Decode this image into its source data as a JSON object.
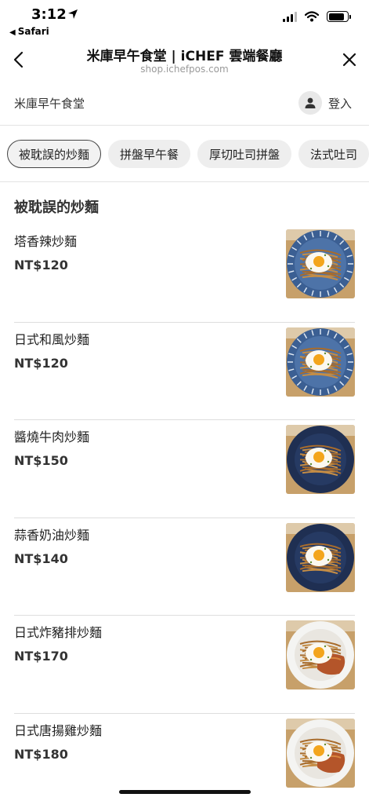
{
  "status_bar": {
    "time": "3:12",
    "back_app": "Safari",
    "signal_bars": 3,
    "battery_level": 0.85
  },
  "nav": {
    "title": "米庫早午食堂 | iCHEF 雲端餐廳",
    "url": "shop.ichefpos.com"
  },
  "store": {
    "name": "米庫早午食堂",
    "login_label": "登入"
  },
  "tabs": [
    {
      "label": "被耽誤的炒麵",
      "active": true
    },
    {
      "label": "拼盤早午餐",
      "active": false
    },
    {
      "label": "厚切吐司拼盤",
      "active": false
    },
    {
      "label": "法式吐司",
      "active": false
    }
  ],
  "section": {
    "title": "被耽誤的炒麵"
  },
  "items": [
    {
      "name": "塔香辣炒麵",
      "price": "NT$120",
      "plate": "blue-pattern"
    },
    {
      "name": "日式和風炒麵",
      "price": "NT$120",
      "plate": "blue-pattern"
    },
    {
      "name": "醬燒牛肉炒麵",
      "price": "NT$150",
      "plate": "navy"
    },
    {
      "name": "蒜香奶油炒麵",
      "price": "NT$140",
      "plate": "navy"
    },
    {
      "name": "日式炸豬排炒麵",
      "price": "NT$170",
      "plate": "white"
    },
    {
      "name": "日式唐揚雞炒麵",
      "price": "NT$180",
      "plate": "white"
    }
  ],
  "colors": {
    "text": "#222222",
    "muted": "#9a9a9a",
    "chip_bg": "#eeeeee",
    "divider": "#dedede",
    "thumb_bg": "#c7a06a"
  }
}
